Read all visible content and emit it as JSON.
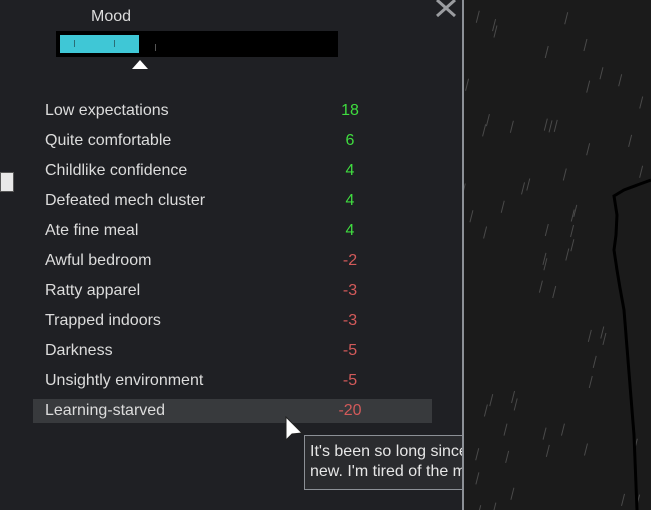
{
  "mood": {
    "label": "Mood",
    "level": 0.29,
    "fill_color": "#3fc7d6"
  },
  "thoughts": [
    {
      "label": "Low expectations",
      "value": "18",
      "kind": "pos"
    },
    {
      "label": "Quite comfortable",
      "value": "6",
      "kind": "pos"
    },
    {
      "label": "Childlike confidence",
      "value": "4",
      "kind": "pos"
    },
    {
      "label": "Defeated mech cluster",
      "value": "4",
      "kind": "pos"
    },
    {
      "label": "Ate fine meal",
      "value": "4",
      "kind": "pos"
    },
    {
      "label": "Awful bedroom",
      "value": "-2",
      "kind": "neg"
    },
    {
      "label": "Ratty apparel",
      "value": "-3",
      "kind": "neg"
    },
    {
      "label": "Trapped indoors",
      "value": "-3",
      "kind": "neg"
    },
    {
      "label": "Darkness",
      "value": "-5",
      "kind": "neg"
    },
    {
      "label": "Unsightly environment",
      "value": "-5",
      "kind": "neg"
    },
    {
      "label": "Learning-starved",
      "value": "-20",
      "kind": "neg",
      "highlighted": true
    }
  ],
  "tooltip": {
    "text": "It's been so long since I learned anything new. I'm tired of the monotony!"
  },
  "colors": {
    "positive": "#3fdc3f",
    "negative": "#d25a5a",
    "panel_bg": "#1f2024"
  },
  "icons": {
    "close": "close-icon",
    "cursor": "mouse-cursor-icon"
  }
}
